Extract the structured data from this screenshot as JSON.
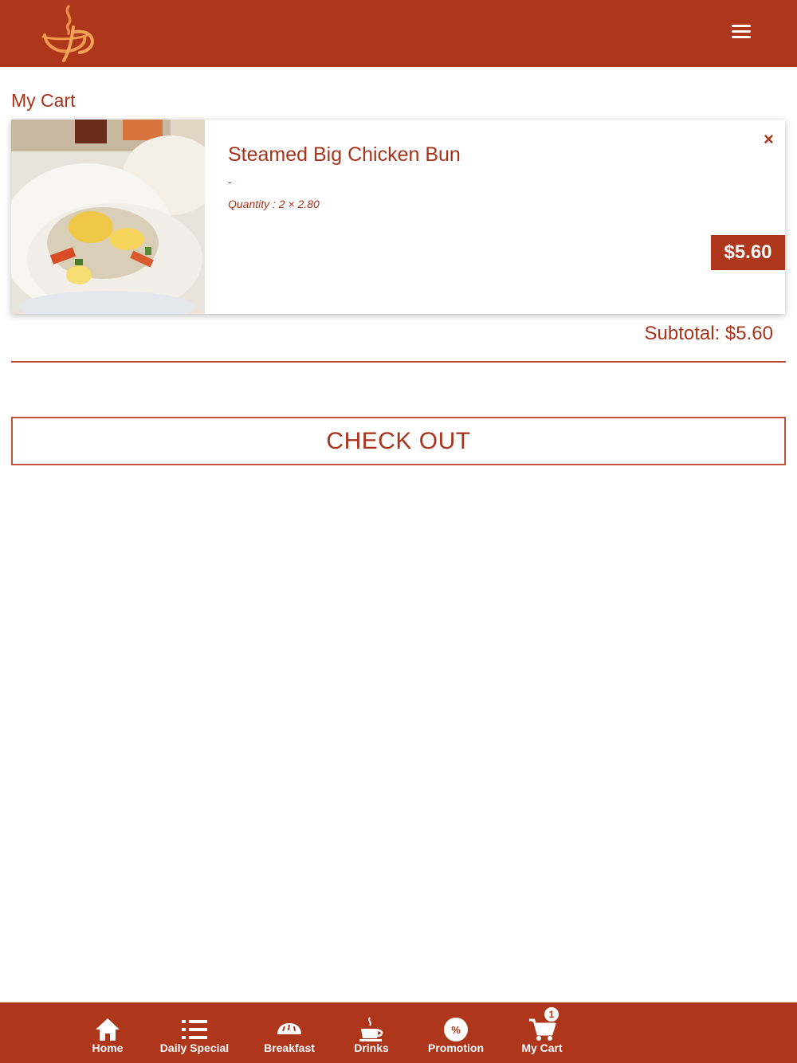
{
  "header": {
    "logo_icon": "coffee-cup-logo-icon",
    "menu_icon": "hamburger-menu-icon"
  },
  "page": {
    "title": "My Cart"
  },
  "cart": {
    "items": [
      {
        "name": "Steamed Big Chicken Bun",
        "note": "-",
        "quantity_text": "Quantity : 2 × 2.80",
        "price": "$5.60",
        "remove_symbol": "×",
        "image_icon": "chicken-bun-photo"
      }
    ],
    "subtotal": "Subtotal: $5.60",
    "checkout_label": "CHECK OUT"
  },
  "nav": {
    "items": [
      {
        "label": "Home",
        "icon": "home-icon"
      },
      {
        "label": "Daily Special",
        "icon": "list-icon"
      },
      {
        "label": "Breakfast",
        "icon": "bread-icon"
      },
      {
        "label": "Drinks",
        "icon": "coffee-cup-icon"
      },
      {
        "label": "Promotion",
        "icon": "percent-icon"
      },
      {
        "label": "My Cart",
        "icon": "cart-icon",
        "badge": "1"
      }
    ]
  },
  "colors": {
    "brand": "#ad361b",
    "text": "#a8331a",
    "background": "#ffffff"
  }
}
